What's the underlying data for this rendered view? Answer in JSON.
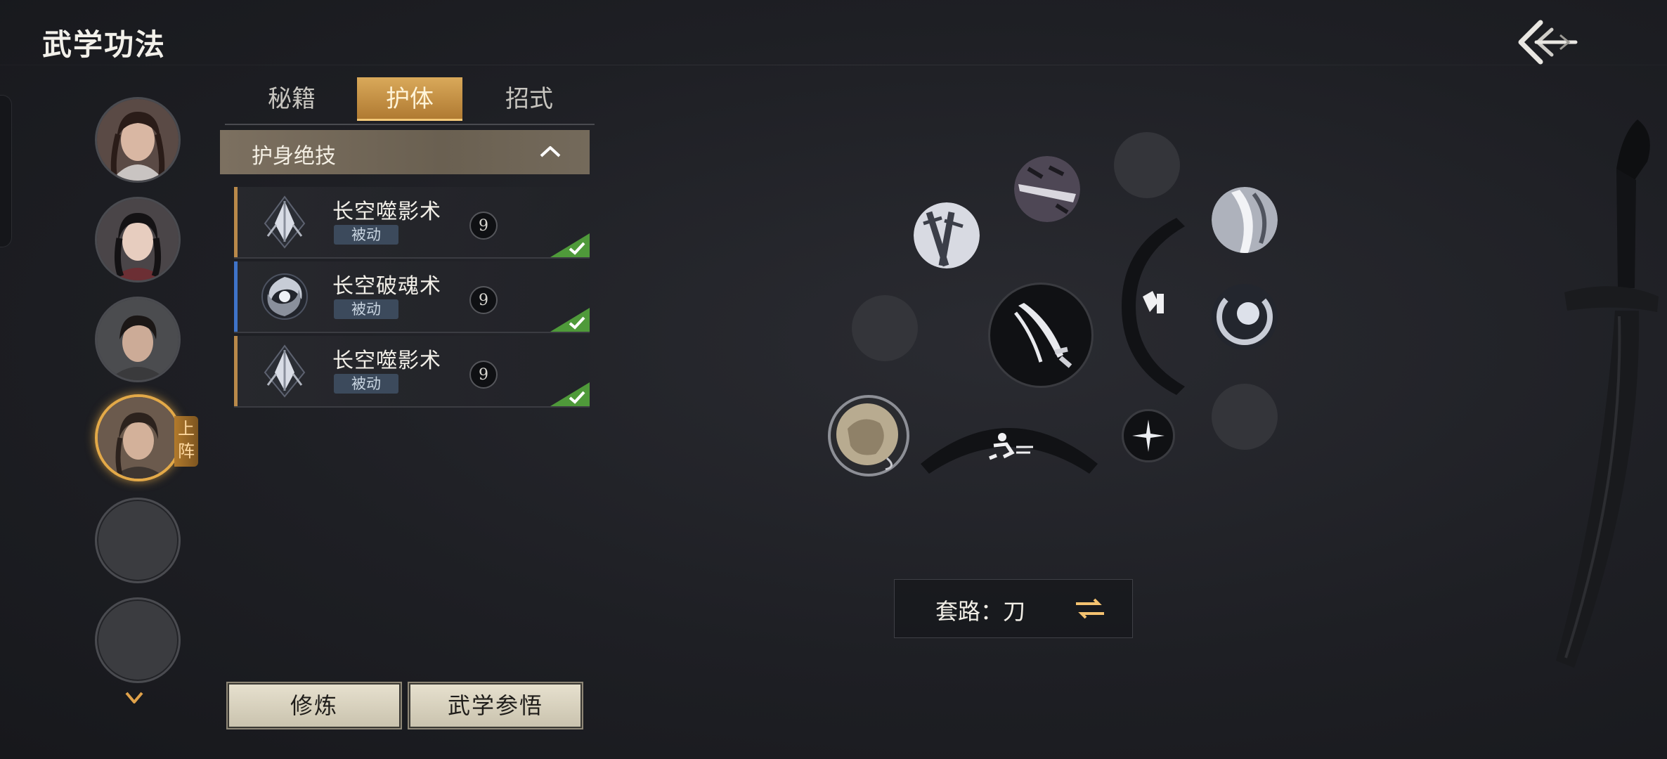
{
  "header": {
    "title": "武学功法"
  },
  "characters": [
    {
      "state": "portrait"
    },
    {
      "state": "portrait"
    },
    {
      "state": "portrait"
    },
    {
      "state": "portrait",
      "active": true,
      "tag": "上阵"
    },
    {
      "state": "empty"
    },
    {
      "state": "empty"
    }
  ],
  "tabs": [
    {
      "label": "秘籍",
      "active": false
    },
    {
      "label": "护体",
      "active": true
    },
    {
      "label": "招式",
      "active": false
    }
  ],
  "section": {
    "title": "护身绝技",
    "expanded": true
  },
  "skills": [
    {
      "name": "长空噬影术",
      "tag": "被动",
      "coin": "9",
      "accent": "#b9894a",
      "equipped": true
    },
    {
      "name": "长空破魂术",
      "tag": "被动",
      "coin": "9",
      "accent": "#3f73c8",
      "equipped": true
    },
    {
      "name": "长空噬影术",
      "tag": "被动",
      "coin": "9",
      "accent": "#b9894a",
      "equipped": true
    }
  ],
  "buttons": {
    "train": "修炼",
    "insight": "武学参悟"
  },
  "route": {
    "label": "套路：刀"
  },
  "colors": {
    "gold": "#e3a948",
    "check_green": "#4f9a3a",
    "panel": "#6a6051"
  },
  "icons": {
    "back": "back-arrow-icon",
    "collapse": "chevron-up-icon",
    "scroll_more": "chevron-down-icon",
    "swap": "swap-arrows-icon"
  }
}
